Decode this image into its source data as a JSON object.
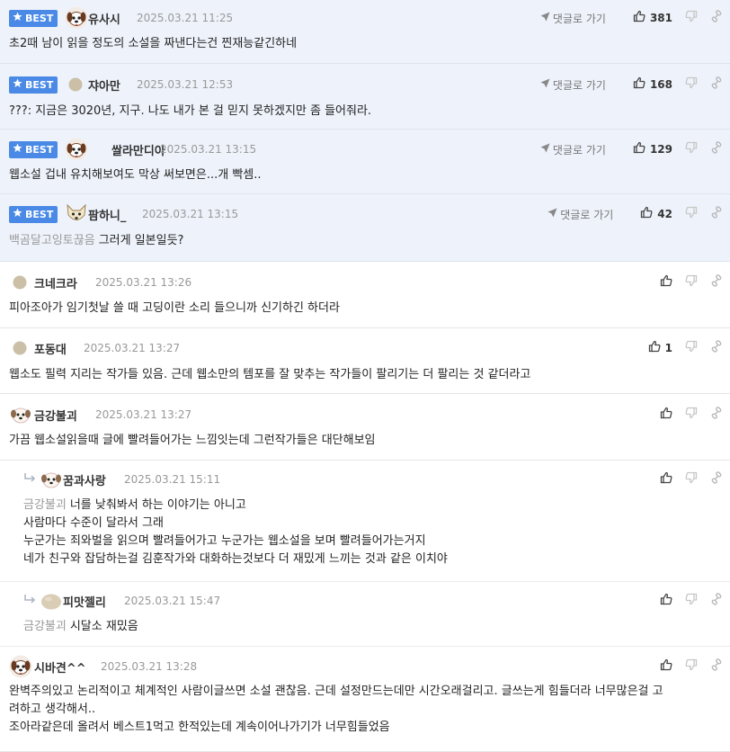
{
  "goto_label": "댓글로 가기",
  "best_label": "BEST",
  "accent_color": "#4a8ae6",
  "comments": [
    {
      "nick": "유사시",
      "time": "2025.03.21 11:25",
      "lines": [
        "초2때 남이 읽을 정도의 소설을 짜낸다는건 찐재능같긴하네"
      ],
      "likes": "381",
      "avatar": "dog-avatar-icon"
    },
    {
      "nick": "쟈아만",
      "time": "2025.03.21 12:53",
      "lines": [
        "???: 지금은 3020년, 지구. 나도 내가 본 걸 믿지 못하겠지만 좀 들어줘라."
      ],
      "likes": "168",
      "avatar": "dot-avatar-icon"
    },
    {
      "nick": "쌀라만디아",
      "time": "2025.03.21 13:15",
      "lines": [
        "웹소설 겁내 유치해보여도 막상 써보면은...개 빡셈.."
      ],
      "likes": "129",
      "avatar": "dog-avatar-icon"
    },
    {
      "nick": "팜하니_",
      "time": "2025.03.21 13:15",
      "mention": "백곰달고잉토끊음",
      "lines": [
        "그러게 일본일듯?"
      ],
      "likes": "42",
      "avatar": "fox-avatar-icon"
    },
    {
      "nick": "크네크라",
      "time": "2025.03.21 13:26",
      "lines": [
        "피아조아가 임기첫날 쓸 때 고딩이란 소리 들으니까 신기하긴 하더라"
      ],
      "likes": "",
      "avatar": "dot-avatar-icon"
    },
    {
      "nick": "포동대",
      "time": "2025.03.21 13:27",
      "lines": [
        "웹소도 필력 지리는 작가들 있음. 근데 웹소만의 템포를 잘 맞추는 작가들이 팔리기는 더 팔리는 것 같더라고"
      ],
      "likes": "1",
      "avatar": "dot-avatar-icon"
    },
    {
      "nick": "금강불괴",
      "time": "2025.03.21 13:27",
      "lines": [
        "가끔 웹소설읽을때 글에 빨려들어가는 느낌잇는데 그런작가들은 대단해보임"
      ],
      "likes": "",
      "avatar": "puppy-avatar-icon"
    },
    {
      "nick": "꿈과사랑",
      "time": "2025.03.21 15:11",
      "mention": "금강불괴",
      "lines": [
        "너를 낮춰봐서 하는 이야기는 아니고",
        "사람마다 수준이 달라서 그래",
        "누군가는 죄와벌을 읽으며 빨려들어가고 누군가는 웹소설을 보며 빨려들어가는거지",
        "네가 친구와 잡담하는걸 김훈작가와 대화하는것보다 더 재밌게 느끼는 것과 같은 이치야"
      ],
      "likes": "",
      "avatar": "puppy-avatar-icon"
    },
    {
      "nick": "피맛젤리",
      "time": "2025.03.21 15:47",
      "mention": "금강불괴",
      "lines": [
        "시달소 재밌음"
      ],
      "likes": "",
      "avatar": "blob-avatar-icon"
    },
    {
      "nick": "시바견^^",
      "time": "2025.03.21 13:28",
      "lines": [
        "완벽주의있고 논리적이고 체계적인 사람이글쓰면 소설 괜찮음. 근데 설정만드는데만 시간오래걸리고. 글쓰는게 힘들더라 너무많은걸 고",
        "려하고 생각해서..",
        "조아라같은데 올려서 베스트1먹고 한적있는데 계속이어나가기가 너무힘들었음"
      ],
      "likes": "",
      "avatar": "dog-avatar-icon"
    }
  ]
}
